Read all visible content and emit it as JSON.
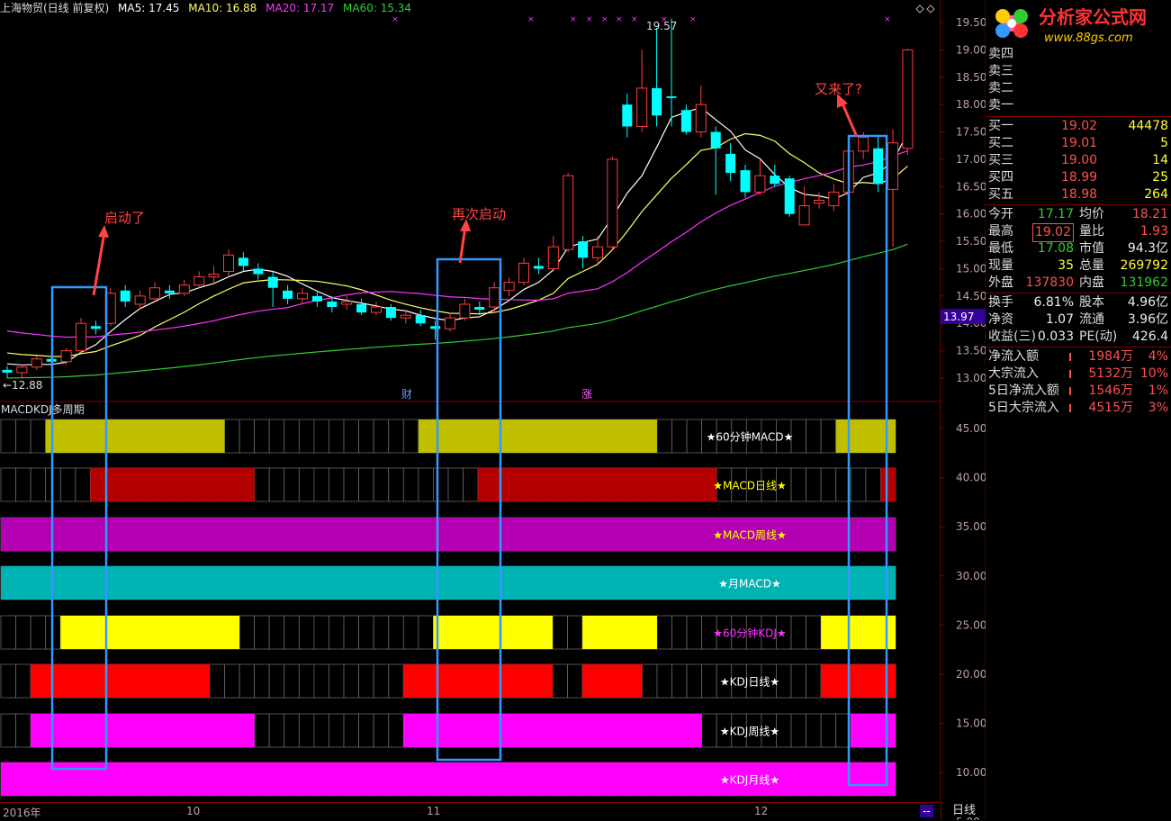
{
  "header": {
    "title": "上海物贸(日线 前复权)",
    "ma5": "MA5: 17.45",
    "ma10": "MA10: 16.88",
    "ma20": "MA20: 17.17",
    "ma60": "MA60: 15.34"
  },
  "colors": {
    "up": "#ff3c3c",
    "down": "#00ffff",
    "ma5": "#ffffff",
    "ma10": "#ffff66",
    "ma20": "#ff33ff",
    "ma60": "#33cc33",
    "frame": "#3399ff"
  },
  "price_axis": [
    "19.50",
    "19.00",
    "18.50",
    "18.00",
    "17.50",
    "17.00",
    "16.50",
    "16.00",
    "15.50",
    "15.00",
    "14.50",
    "14.00",
    "13.50",
    "13.00"
  ],
  "price_markers": {
    "high": "19.57",
    "low": "←12.88",
    "current": "13.97"
  },
  "annotations": {
    "a1": "启动了",
    "a2": "再次启动",
    "a3": "又来了?"
  },
  "event_tags": {
    "cai": "财",
    "zhang": "涨"
  },
  "indicator": {
    "title": "MACDKDJ多周期",
    "axis": [
      "45.00",
      "40.00",
      "35.00",
      "30.00",
      "25.00",
      "20.00",
      "15.00",
      "10.00",
      "5.00"
    ],
    "bands": [
      {
        "label": "★60分钟MACD★",
        "color": "#bfbf00",
        "label_color": "#ffffff",
        "segments": [
          [
            3,
            15
          ],
          [
            28,
            44
          ],
          [
            56,
            60
          ]
        ]
      },
      {
        "label": "★MACD日线★",
        "color": "#b30000",
        "label_color": "#ffff00",
        "segments": [
          [
            6,
            17
          ],
          [
            32,
            48
          ],
          [
            59,
            60
          ]
        ]
      },
      {
        "label": "★MACD周线★",
        "color": "#b300b3",
        "label_color": "#ffff00",
        "segments": [
          [
            0,
            60
          ]
        ]
      },
      {
        "label": "★月MACD★",
        "color": "#00b3b3",
        "label_color": "#ffffff",
        "segments": [
          [
            0,
            60
          ]
        ]
      },
      {
        "label": "★60分钟KDJ★",
        "color": "#ffff00",
        "label_color": "#ff33ff",
        "segments": [
          [
            4,
            16
          ],
          [
            29,
            37
          ],
          [
            39,
            44
          ],
          [
            55,
            60
          ]
        ]
      },
      {
        "label": "★KDJ日线★",
        "color": "#ff0000",
        "label_color": "#ffffff",
        "segments": [
          [
            2,
            14
          ],
          [
            27,
            37
          ],
          [
            39,
            43
          ],
          [
            55,
            60
          ]
        ]
      },
      {
        "label": "★KDJ周线★",
        "color": "#ff00ff",
        "label_color": "#ffffff",
        "segments": [
          [
            2,
            17
          ],
          [
            27,
            47
          ],
          [
            57,
            60
          ]
        ]
      },
      {
        "label": "★KDJ月线★",
        "color": "#ff00ff",
        "label_color": "#ffffff",
        "segments": [
          [
            0,
            60
          ]
        ]
      }
    ]
  },
  "date_axis": {
    "d1": "2016年",
    "d2": "10",
    "d3": "11",
    "d4": "12",
    "end": "--"
  },
  "period": "日线",
  "logo": {
    "name": "分析家公式网",
    "url": "www.88gs.com"
  },
  "quote": {
    "sell": [
      {
        "label": "卖四",
        "price": "",
        "vol": ""
      },
      {
        "label": "卖三",
        "price": "",
        "vol": ""
      },
      {
        "label": "卖二",
        "price": "",
        "vol": ""
      },
      {
        "label": "卖一",
        "price": "",
        "vol": ""
      }
    ],
    "buy": [
      {
        "label": "买一",
        "price": "19.02",
        "vol": "44478"
      },
      {
        "label": "买二",
        "price": "19.01",
        "vol": "5"
      },
      {
        "label": "买三",
        "price": "19.00",
        "vol": "14"
      },
      {
        "label": "买四",
        "price": "18.99",
        "vol": "25"
      },
      {
        "label": "买五",
        "price": "18.98",
        "vol": "264"
      }
    ],
    "stats": [
      {
        "l1": "今开",
        "v1": "17.17",
        "c1": "green",
        "l2": "均价",
        "v2": "18.21",
        "c2": "red"
      },
      {
        "l1": "最高",
        "v1": "19.02",
        "c1": "red",
        "l2": "量比",
        "v2": "1.93",
        "c2": "red"
      },
      {
        "l1": "最低",
        "v1": "17.08",
        "c1": "green",
        "l2": "市值",
        "v2": "94.3亿",
        "c2": "wht"
      },
      {
        "l1": "现量",
        "v1": "35",
        "c1": "yel",
        "l2": "总量",
        "v2": "269792",
        "c2": "yel"
      },
      {
        "l1": "外盘",
        "v1": "137830",
        "c1": "red",
        "l2": "内盘",
        "v2": "131962",
        "c2": "green"
      },
      {
        "l1": "换手",
        "v1": "6.81%",
        "c1": "wht",
        "l2": "股本",
        "v2": "4.96亿",
        "c2": "wht"
      },
      {
        "l1": "净资",
        "v1": "1.07",
        "c1": "wht",
        "l2": "流通",
        "v2": "3.96亿",
        "c2": "wht"
      },
      {
        "l1": "收益(三)",
        "v1": "0.033",
        "c1": "wht",
        "l2": "PE(动)",
        "v2": "426.4",
        "c2": "wht"
      }
    ],
    "flows": [
      {
        "label": "净流入额",
        "value": "1984万",
        "pct": "4%"
      },
      {
        "label": "大宗流入",
        "value": "5132万",
        "pct": "10%"
      },
      {
        "label": "5日净流入额",
        "value": "1546万",
        "pct": "1%"
      },
      {
        "label": "5日大宗流入",
        "value": "4515万",
        "pct": "3%"
      }
    ]
  },
  "chart_data": {
    "type": "candlestick",
    "ylim": [
      12.8,
      19.8
    ],
    "candles": [
      [
        13.15,
        13.1,
        13.22,
        13.0
      ],
      [
        13.1,
        13.2,
        13.25,
        13.0
      ],
      [
        13.2,
        13.35,
        13.4,
        13.15
      ],
      [
        13.35,
        13.3,
        13.45,
        13.2
      ],
      [
        13.3,
        13.5,
        13.55,
        13.25
      ],
      [
        13.5,
        14.0,
        14.1,
        13.45
      ],
      [
        13.95,
        13.9,
        14.05,
        13.8
      ],
      [
        14.0,
        14.55,
        14.65,
        13.95
      ],
      [
        14.6,
        14.4,
        14.7,
        14.3
      ],
      [
        14.35,
        14.5,
        14.6,
        14.25
      ],
      [
        14.45,
        14.65,
        14.75,
        14.4
      ],
      [
        14.6,
        14.55,
        14.7,
        14.45
      ],
      [
        14.55,
        14.7,
        14.8,
        14.5
      ],
      [
        14.7,
        14.85,
        14.95,
        14.65
      ],
      [
        14.85,
        14.9,
        15.05,
        14.7
      ],
      [
        14.95,
        15.25,
        15.35,
        14.85
      ],
      [
        15.2,
        15.05,
        15.3,
        14.95
      ],
      [
        15.0,
        14.9,
        15.1,
        14.8
      ],
      [
        14.85,
        14.65,
        14.95,
        14.3
      ],
      [
        14.6,
        14.45,
        14.7,
        14.35
      ],
      [
        14.45,
        14.55,
        14.65,
        14.35
      ],
      [
        14.5,
        14.4,
        14.6,
        14.3
      ],
      [
        14.4,
        14.3,
        14.5,
        14.2
      ],
      [
        14.35,
        14.4,
        14.5,
        14.25
      ],
      [
        14.35,
        14.2,
        14.45,
        14.15
      ],
      [
        14.2,
        14.3,
        14.4,
        14.15
      ],
      [
        14.3,
        14.1,
        14.35,
        14.05
      ],
      [
        14.1,
        14.15,
        14.25,
        14.0
      ],
      [
        14.15,
        14.0,
        14.25,
        13.95
      ],
      [
        13.95,
        13.9,
        14.05,
        13.7
      ],
      [
        13.9,
        14.1,
        14.2,
        13.85
      ],
      [
        14.1,
        14.35,
        14.45,
        14.05
      ],
      [
        14.3,
        14.25,
        14.4,
        14.15
      ],
      [
        14.3,
        14.65,
        14.75,
        14.2
      ],
      [
        14.6,
        14.75,
        14.85,
        14.5
      ],
      [
        14.75,
        15.1,
        15.2,
        14.7
      ],
      [
        15.05,
        15.0,
        15.2,
        14.9
      ],
      [
        15.0,
        15.4,
        15.6,
        14.95
      ],
      [
        15.35,
        16.7,
        16.75,
        15.3
      ],
      [
        15.5,
        15.2,
        15.6,
        15.0
      ],
      [
        15.2,
        15.4,
        15.6,
        15.05
      ],
      [
        15.4,
        17.0,
        17.05,
        15.35
      ],
      [
        18.0,
        17.6,
        18.2,
        17.4
      ],
      [
        17.6,
        18.3,
        19.0,
        17.5
      ],
      [
        18.3,
        17.8,
        19.4,
        17.6
      ],
      [
        18.15,
        18.12,
        19.57,
        17.6
      ],
      [
        17.9,
        17.5,
        18.0,
        17.45
      ],
      [
        17.5,
        18.0,
        18.35,
        17.4
      ],
      [
        17.5,
        17.2,
        17.6,
        16.35
      ],
      [
        17.1,
        16.75,
        17.3,
        16.6
      ],
      [
        16.8,
        16.4,
        16.9,
        16.3
      ],
      [
        16.4,
        16.7,
        17.0,
        16.35
      ],
      [
        16.7,
        16.55,
        16.9,
        16.5
      ],
      [
        16.65,
        16.0,
        16.7,
        15.95
      ],
      [
        15.8,
        16.15,
        16.5,
        15.8
      ],
      [
        16.2,
        16.25,
        16.4,
        16.1
      ],
      [
        16.15,
        16.4,
        16.55,
        16.05
      ],
      [
        16.4,
        17.15,
        17.3,
        16.35
      ],
      [
        17.15,
        17.4,
        17.5,
        17.0
      ],
      [
        17.2,
        16.55,
        17.45,
        16.4
      ],
      [
        16.45,
        17.3,
        17.55,
        15.4
      ],
      [
        17.2,
        19.0,
        19.02,
        17.08
      ]
    ]
  }
}
